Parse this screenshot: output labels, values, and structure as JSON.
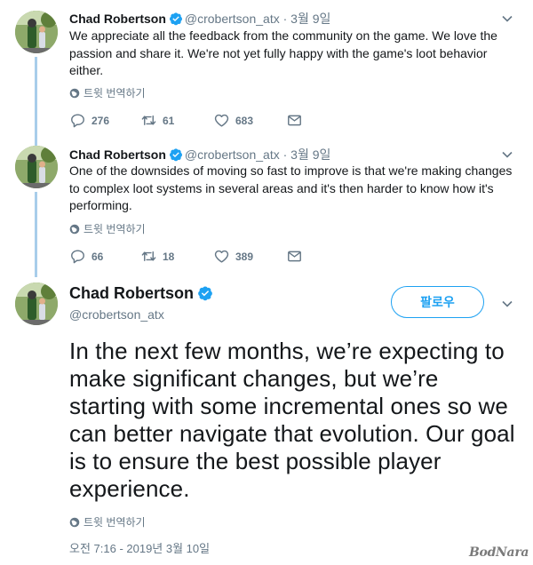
{
  "tweets": [
    {
      "name": "Chad Robertson",
      "handle": "@crobertson_atx",
      "separator": "·",
      "date": "3월 9일",
      "text": "We appreciate all the feedback from the community on the game. We love the passion and share it. We're not yet fully happy with the game's loot behavior either.",
      "translate_label": "트윗 번역하기",
      "replies": "276",
      "retweets": "61",
      "likes": "683"
    },
    {
      "name": "Chad Robertson",
      "handle": "@crobertson_atx",
      "separator": "·",
      "date": "3월 9일",
      "text": "One of the downsides of moving so fast to improve is that we're making changes to complex loot systems in several areas and it's then harder to know how it's performing.",
      "translate_label": "트윗 번역하기",
      "replies": "66",
      "retweets": "18",
      "likes": "389"
    }
  ],
  "main_tweet": {
    "name": "Chad Robertson",
    "handle": "@crobertson_atx",
    "follow_label": "팔로우",
    "text": "In the next few months, we’re expecting to make significant changes, but we’re starting with some incremental ones so we can better navigate that evolution. Our goal is to ensure the best possible player experience.",
    "translate_label": "트윗 번역하기",
    "timestamp": "오전 7:16 - 2019년 3월 10일"
  },
  "watermark": "BodNara",
  "colors": {
    "accent": "#1da1f2",
    "text": "#14171a",
    "muted": "#657786",
    "thread_line": "#a8cdea"
  }
}
